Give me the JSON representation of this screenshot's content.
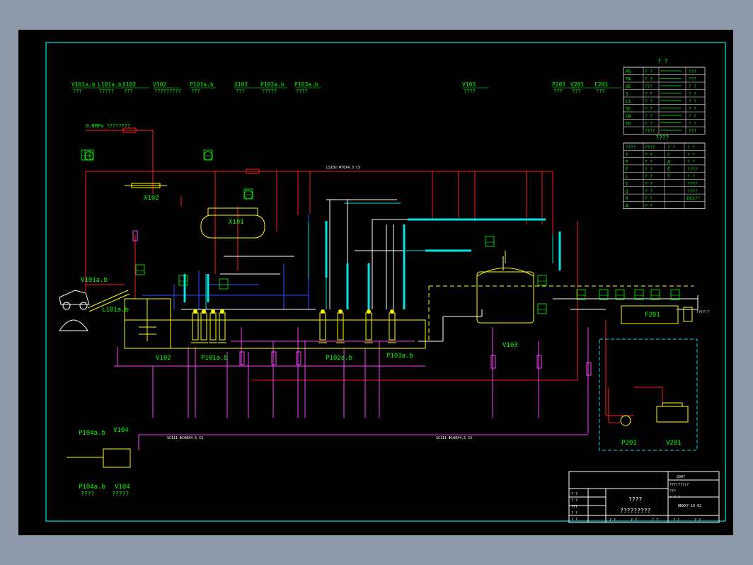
{
  "colors": {
    "background": "#8e9aaa",
    "sheet": "#000000",
    "frame": "#00e5e5",
    "equipment": "#ffff00",
    "label": "#00ff00",
    "steam_line": "#ff2020",
    "process_line": "#ff40ff",
    "water_line": "#3050ff"
  },
  "equipment_header": [
    {
      "tag": "V101a.b",
      "name": "???"
    },
    {
      "tag": "L101a.b",
      "name": "?????"
    },
    {
      "tag": "X102",
      "name": "???"
    },
    {
      "tag": "V102",
      "name": "?????????"
    },
    {
      "tag": "P101a.b",
      "name": "???"
    },
    {
      "tag": "X101",
      "name": "???"
    },
    {
      "tag": "P102a.b",
      "name": "?????"
    },
    {
      "tag": "P103a.b",
      "name": "????"
    },
    {
      "tag": "V103",
      "name": "????"
    },
    {
      "tag": "P201",
      "name": "???"
    },
    {
      "tag": "V201",
      "name": "???"
    },
    {
      "tag": "F201",
      "name": "???"
    }
  ],
  "diagram_labels": {
    "steam_source": "0.8MPa ????????",
    "x102": "X102",
    "x101": "X101",
    "v101": "V101a.b",
    "l101": "L101a.b",
    "v102": "V102",
    "p101": "P101a.b",
    "p102": "P102a.b",
    "p103": "P103a.b",
    "v103": "V103",
    "f201": "F201",
    "p201": "P201",
    "v201": "V201",
    "p104": "P104a.b",
    "v104": "V104",
    "p104_name": "????",
    "v104_name": "?????",
    "main_header_line": "LS102-Φ76X4.5 CS",
    "bottom_header_line": "SC111-Φ108X4.5 CS",
    "bottom_header_line_2": "SC111-Φ108X4.5 CS",
    "outlet": "??(?)?"
  },
  "legend_top": {
    "title": "? ?",
    "rows": [
      {
        "code": "PG",
        "text": "? ?"
      },
      {
        "code": "PA",
        "text": "? ?"
      },
      {
        "code": "VE",
        "text": "???"
      },
      {
        "code": "S",
        "text": "? ?"
      },
      {
        "code": "LS",
        "text": "? ?"
      },
      {
        "code": "SC",
        "text": "? ?"
      },
      {
        "code": "CW",
        "text": "? ?"
      },
      {
        "code": "PO",
        "text": "? ?"
      },
      {
        "code": "",
        "text": "????"
      }
    ],
    "right_labels": [
      "???",
      "???",
      "? ?",
      "? ?",
      "? ?",
      "? ?",
      "? ?",
      "? ?",
      "???"
    ]
  },
  "legend_bottom": {
    "title": "????",
    "header": [
      "????",
      "????",
      "? ?",
      "? ?"
    ],
    "rows": [
      [
        "T",
        "? ?",
        "C",
        "? ?"
      ],
      [
        "P",
        "? ?",
        "A",
        "? ?"
      ],
      [
        "F",
        "? ?",
        "E",
        "????"
      ],
      [
        "L",
        "? ?",
        "T",
        "? ?"
      ],
      [
        "I",
        "? ?",
        "",
        "????"
      ],
      [
        "Q",
        "? ?",
        "",
        "????"
      ],
      [
        "R",
        "? ?",
        "",
        "DCS??"
      ],
      [
        "A",
        "? ?",
        "",
        ""
      ]
    ]
  },
  "title_block": {
    "main_title": "????",
    "subtitle": "?????????",
    "rev": "200?",
    "drawing_no": "HBXX?-16-02",
    "left_rows": [
      "? ?",
      "? ?",
      "???",
      "? ?",
      "? ?"
    ],
    "right_rows": [
      "???(???)?",
      "???",
      "? ? ?"
    ],
    "bottom_cells": [
      "? ?",
      "? ?",
      "? ?",
      "? ?",
      "? ?"
    ]
  }
}
